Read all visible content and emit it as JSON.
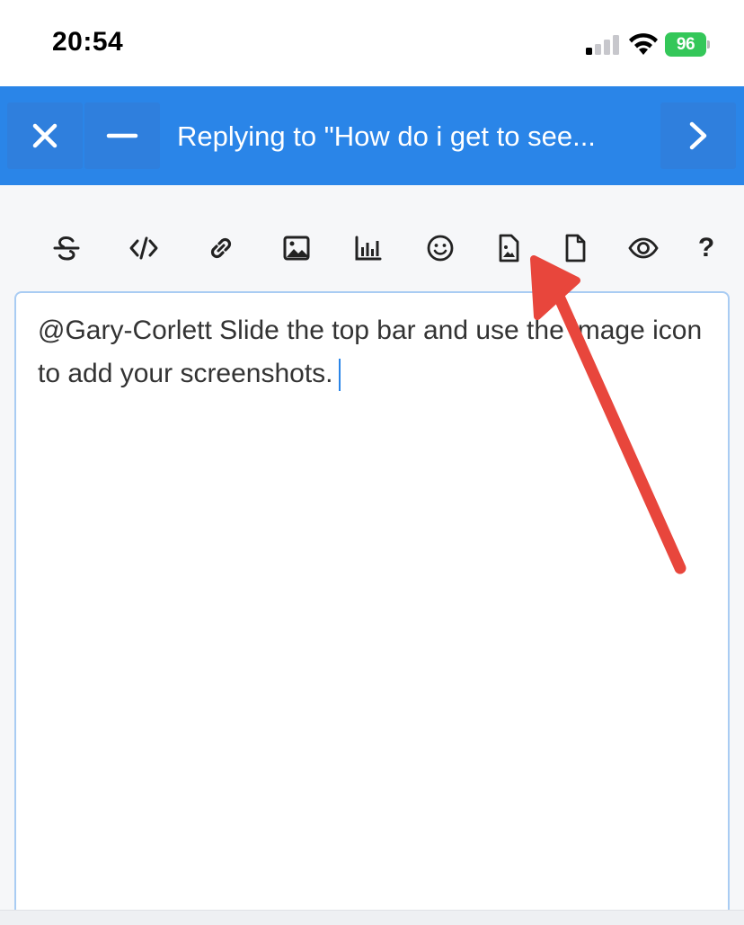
{
  "status_bar": {
    "time": "20:54",
    "battery_level": "96",
    "icons": [
      "cellular-signal-icon",
      "wifi-icon",
      "battery-charging-icon"
    ]
  },
  "header": {
    "title": "Replying to \"How do i get to see...",
    "buttons": [
      "close-icon",
      "minimize-icon",
      "chevron-right-icon"
    ]
  },
  "toolbar": {
    "tools": [
      "strikethrough-icon",
      "code-icon",
      "link-icon",
      "image-icon",
      "chart-icon",
      "emoji-icon",
      "image-file-icon",
      "file-icon",
      "preview-eye-icon",
      "help-icon"
    ],
    "help_label": "?"
  },
  "editor": {
    "text": "@Gary-Corlett Slide the top bar and use the image icon to add your screenshots."
  },
  "colors": {
    "header_bg": "#2a85e8",
    "editor_border": "#a9ccf3",
    "annotation_arrow": "#e8463c",
    "battery": "#34c759"
  }
}
